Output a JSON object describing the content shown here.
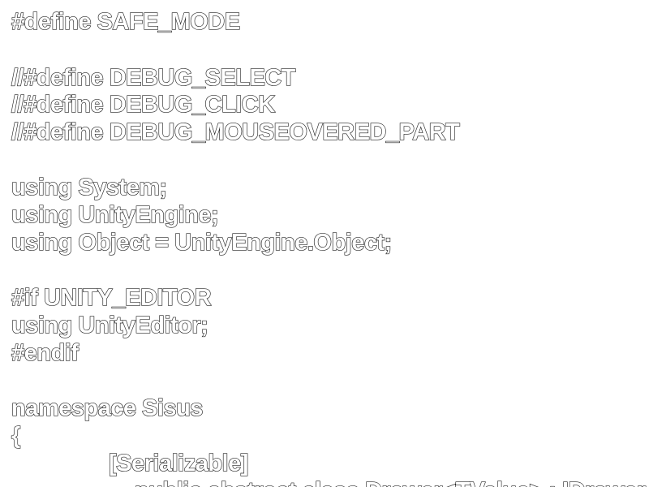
{
  "editor": {
    "lines": [
      "#define SAFE_MODE",
      "",
      "//#define DEBUG_SELECT",
      "//#define DEBUG_CLICK",
      "//#define DEBUG_MOUSEOVERED_PART",
      "",
      "using System;",
      "using UnityEngine;",
      "using Object = UnityEngine.Object;",
      "",
      "#if UNITY_EDITOR",
      "using UnityEditor;",
      "#endif",
      "",
      "namespace Sisus",
      "{",
      "[Serializable]",
      "public abstract class Drawer<TValue> : IDrawer"
    ]
  }
}
